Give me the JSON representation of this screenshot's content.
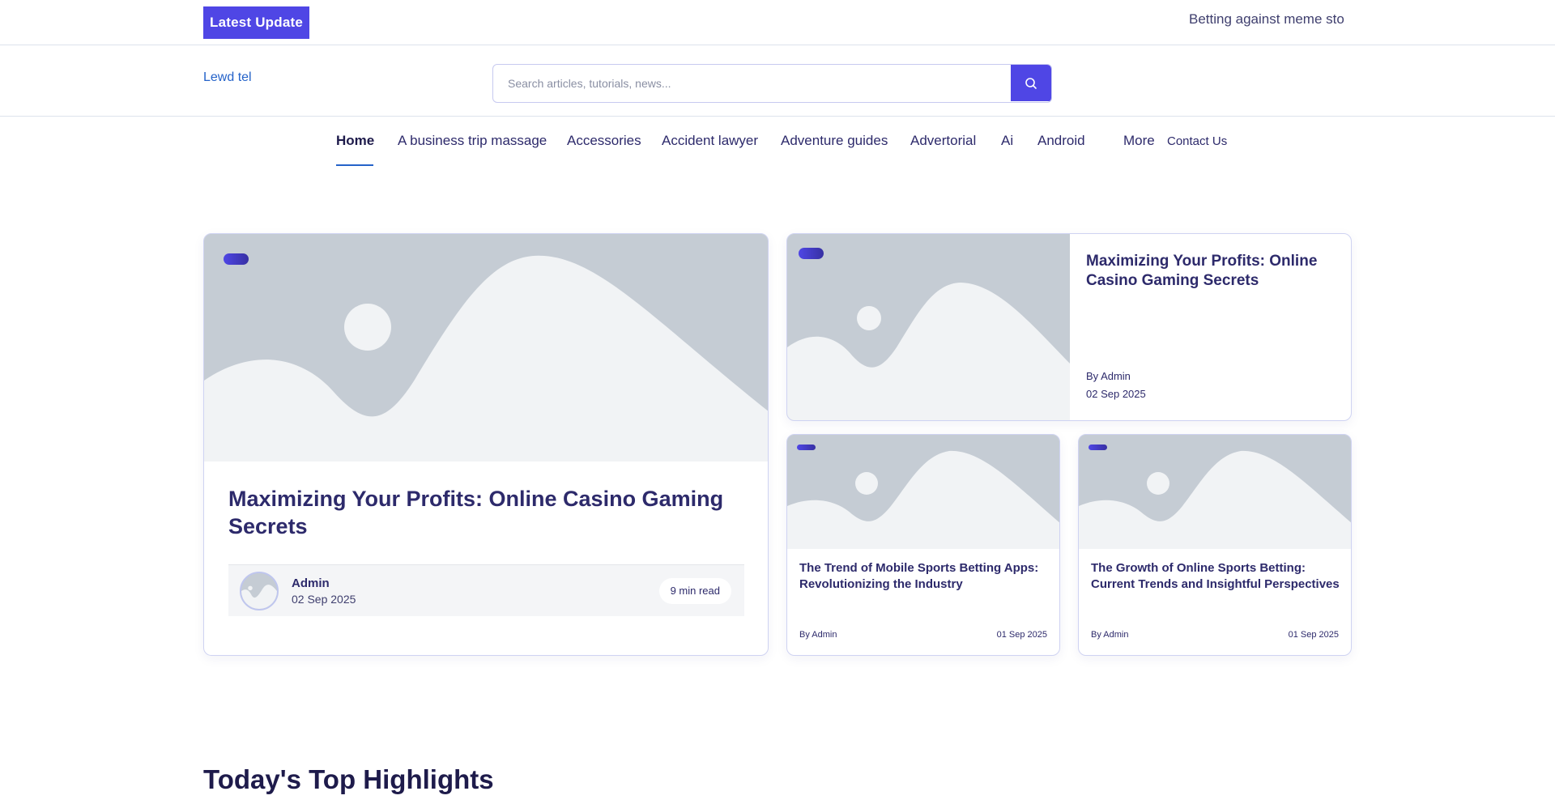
{
  "topbar": {
    "latest_label": "Latest  Update",
    "ticker_text": "Betting against meme sto"
  },
  "header": {
    "site_name": "Lewd tel",
    "search": {
      "placeholder": "Search articles, tutorials, news...",
      "value": "",
      "button_icon": "search-icon"
    }
  },
  "nav": {
    "items": [
      {
        "label": "Home",
        "active": true
      },
      {
        "label": "A business trip massage"
      },
      {
        "label": "Accessories"
      },
      {
        "label": "Accident lawyer"
      },
      {
        "label": "Adventure guides"
      },
      {
        "label": "Advertorial"
      },
      {
        "label": "Ai"
      },
      {
        "label": "Android"
      },
      {
        "label": "More"
      },
      {
        "label": "Contact Us"
      }
    ]
  },
  "featured": {
    "main": {
      "title": "Maximizing Your Profits: Online Casino Gaming Secrets",
      "author": "Admin",
      "date": "02 Sep 2025",
      "read_time": "9 min read"
    },
    "right_top": {
      "title": "Maximizing Your Profits: Online Casino Gaming Secrets",
      "by": "By Admin",
      "date": "02 Sep 2025"
    },
    "small": [
      {
        "title": "The Trend of Mobile Sports Betting Apps: Revolutionizing the Industry",
        "by": "By Admin",
        "date": "01 Sep 2025"
      },
      {
        "title": "The Growth of Online Sports Betting: Current Trends and Insightful Perspectives",
        "by": "By Admin",
        "date": "01 Sep 2025"
      }
    ]
  },
  "sections": {
    "highlights_title": "Today's Top Highlights"
  },
  "colors": {
    "accent": "#4f46e5",
    "link": "#2563c9",
    "text": "#2d2a6b",
    "placeholder_bg": "#c5ccd4",
    "placeholder_fg": "#f1f3f5"
  }
}
